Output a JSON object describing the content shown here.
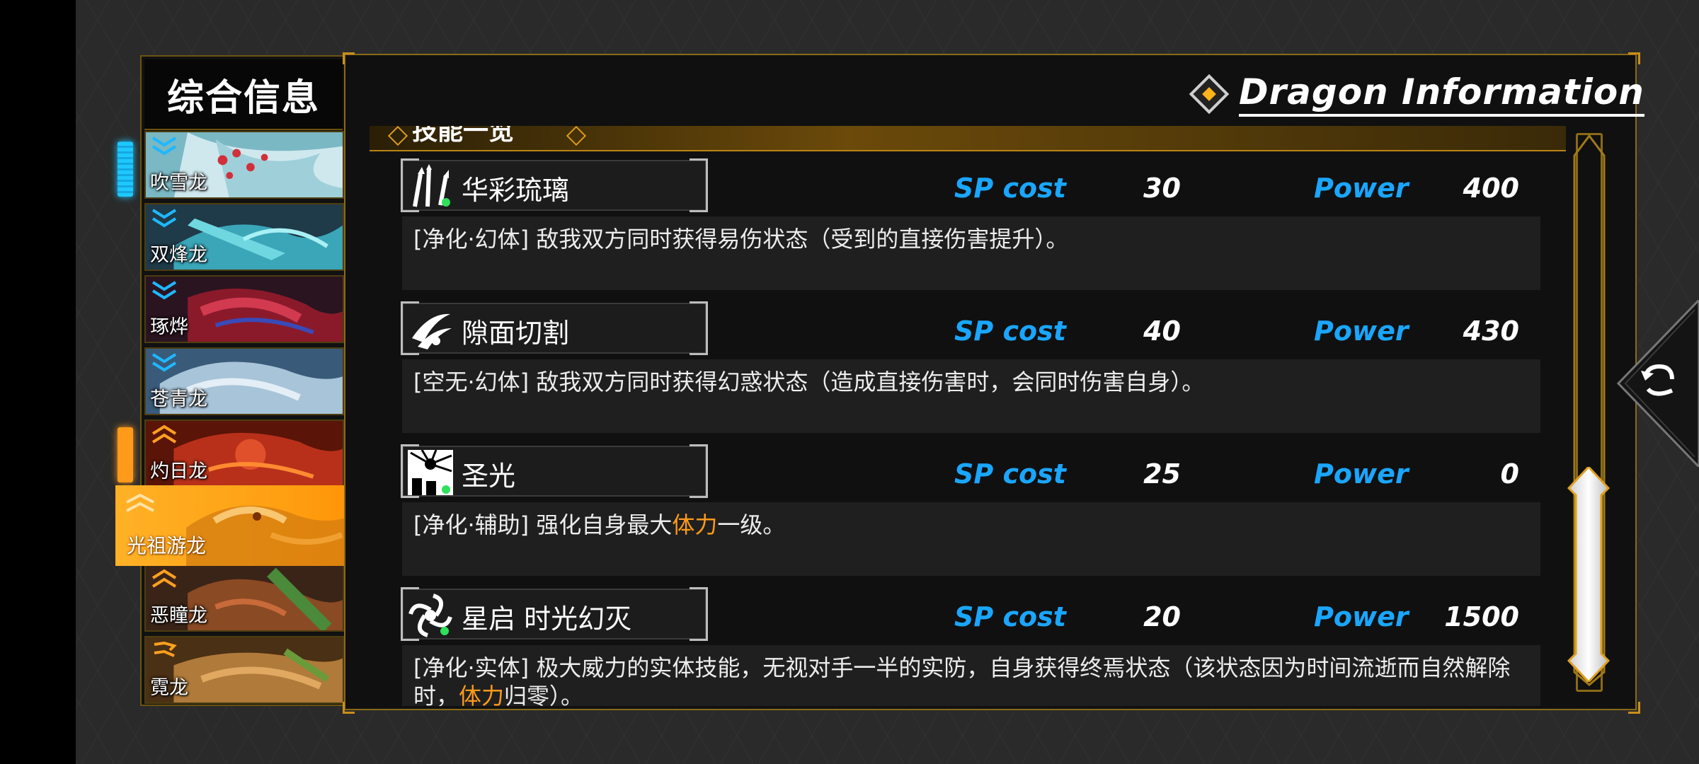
{
  "sidebar": {
    "title": "综合信息",
    "dragons": [
      {
        "name": "吹雪龙",
        "element": "cyan"
      },
      {
        "name": "双烽龙",
        "element": "cyan"
      },
      {
        "name": "琢烨",
        "element": "cyan"
      },
      {
        "name": "苍青龙",
        "element": "cyan"
      },
      {
        "name": "灼日龙",
        "element": "orange"
      },
      {
        "name": "光祖游龙",
        "element": "orange",
        "selected": true
      },
      {
        "name": "恶瞳龙",
        "element": "orange"
      },
      {
        "name": "霓龙",
        "element": "orange"
      }
    ]
  },
  "panel": {
    "title": "Dragon Information",
    "section_label": "技能一览"
  },
  "labels": {
    "sp_cost": "SP cost",
    "power": "Power"
  },
  "skills": [
    {
      "name": "华彩琉璃",
      "icon": "claw-spark-icon",
      "sp_cost": "30",
      "power": "400",
      "desc_pre": "[净化·幻体] 敌我双方同时获得易伤状态（受到的直接伤害提升）。",
      "desc_hl": "",
      "desc_post": ""
    },
    {
      "name": "隙面切割",
      "icon": "slash-icon",
      "sp_cost": "40",
      "power": "430",
      "desc_pre": "[空无·幻体] 敌我双方同时获得幻惑状态（造成直接伤害时，会同时伤害自身）。",
      "desc_hl": "",
      "desc_post": ""
    },
    {
      "name": "圣光",
      "icon": "holy-light-icon",
      "sp_cost": "25",
      "power": "0",
      "desc_pre": "[净化·辅助] 强化自身最大",
      "desc_hl": "体力",
      "desc_post": "一级。"
    },
    {
      "name": "星启 时光幻灭",
      "icon": "vortex-icon",
      "sp_cost": "20",
      "power": "1500",
      "desc_pre": "[净化·实体] 极大威力的实体技能，无视对手一半的实防，自身获得终焉状态（该状态因为时间流逝而自然解除时，",
      "desc_hl": "体力",
      "desc_post": "归零）。"
    }
  ],
  "colors": {
    "accent_gold": "#c98f1a",
    "stat_blue": "#1aa6ff",
    "highlight_orange": "#ff9a1a",
    "selected_orange": "#ffa515"
  }
}
